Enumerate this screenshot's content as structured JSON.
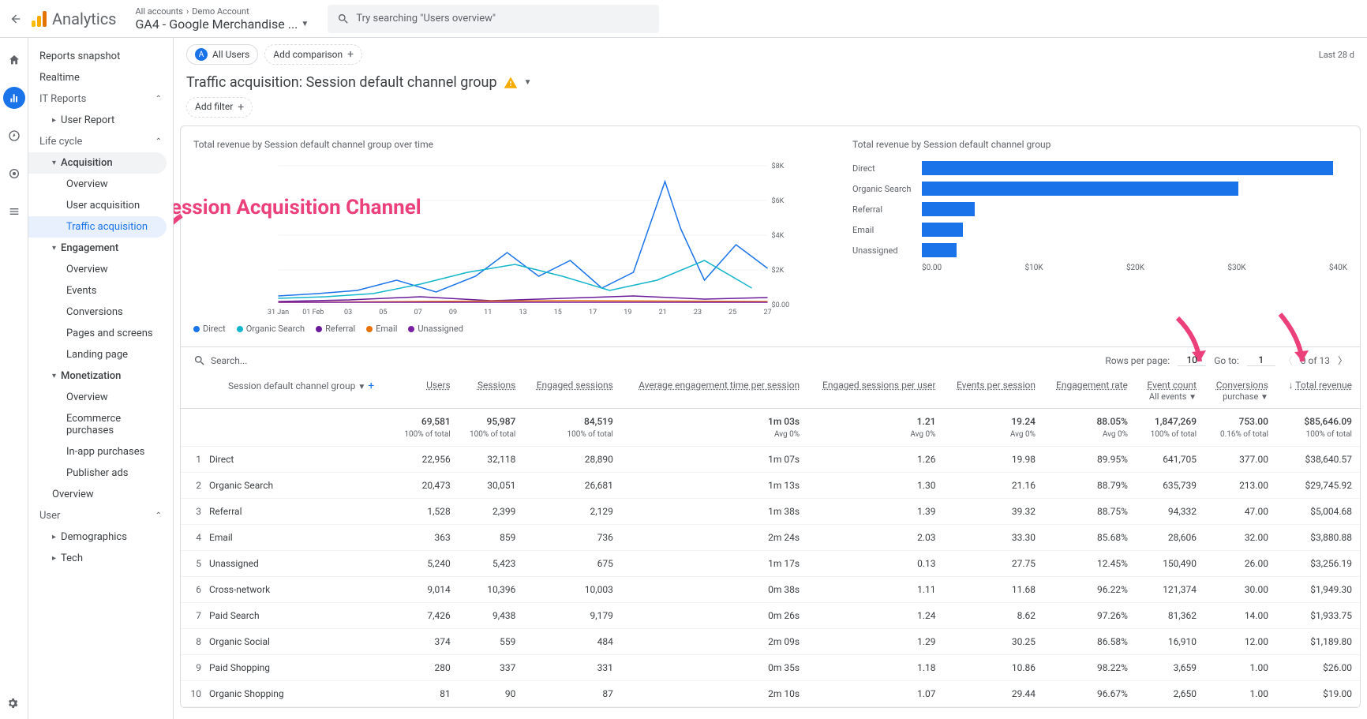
{
  "header": {
    "product": "Analytics",
    "breadcrumb_all": "All accounts",
    "breadcrumb_acct": "Demo Account",
    "property": "GA4 - Google Merchandise ...",
    "search_placeholder": "Try searching \"Users overview\""
  },
  "sidebar": {
    "snapshot": "Reports snapshot",
    "realtime": "Realtime",
    "it_reports": "IT Reports",
    "user_report": "User Report",
    "lifecycle": "Life cycle",
    "acquisition": "Acquisition",
    "acq_overview": "Overview",
    "user_acquisition": "User acquisition",
    "traffic_acquisition": "Traffic acquisition",
    "engagement": "Engagement",
    "eng_overview": "Overview",
    "events": "Events",
    "conversions": "Conversions",
    "pages": "Pages and screens",
    "landing": "Landing page",
    "monetization": "Monetization",
    "mon_overview": "Overview",
    "ecom": "Ecommerce purchases",
    "inapp": "In-app purchases",
    "pubads": "Publisher ads",
    "overview": "Overview",
    "user": "User",
    "demographics": "Demographics",
    "tech": "Tech"
  },
  "chips": {
    "all_users": "All Users",
    "add_comparison": "Add comparison",
    "date_label": "Last 28 d"
  },
  "title": {
    "text": "Traffic acquisition: Session default channel group",
    "add_filter": "Add filter"
  },
  "annotation": {
    "text": "Session Acquisition Channel"
  },
  "line_chart_title": "Total revenue by Session default channel group over time",
  "bar_chart_title": "Total revenue by Session default channel group",
  "chart_data": [
    {
      "type": "line",
      "title": "Total revenue by Session default channel group over time",
      "xlabel": "",
      "ylabel": "",
      "y_ticks": [
        "$0.00",
        "$2K",
        "$4K",
        "$6K",
        "$8K"
      ],
      "x_ticks": [
        "31 Jan",
        "01 Feb",
        "03",
        "05",
        "07",
        "09",
        "11",
        "13",
        "15",
        "17",
        "19",
        "21",
        "23",
        "25",
        "27"
      ],
      "series": [
        {
          "name": "Direct",
          "color": "#1a73e8"
        },
        {
          "name": "Organic Search",
          "color": "#12b5cb"
        },
        {
          "name": "Referral",
          "color": "#6a1b9a"
        },
        {
          "name": "Email",
          "color": "#e8710a"
        },
        {
          "name": "Unassigned",
          "color": "#7b1fa2"
        }
      ]
    },
    {
      "type": "bar",
      "title": "Total revenue by Session default channel group",
      "categories": [
        "Direct",
        "Organic Search",
        "Referral",
        "Email",
        "Unassigned"
      ],
      "values": [
        38640.57,
        29745.92,
        5004.68,
        3880.88,
        3256.19
      ],
      "x_ticks": [
        "$0.00",
        "$10K",
        "$20K",
        "$30K",
        "$40K"
      ],
      "xlim": [
        0,
        40000
      ]
    }
  ],
  "legend": [
    "Direct",
    "Organic Search",
    "Referral",
    "Email",
    "Unassigned"
  ],
  "legend_colors": [
    "#1a73e8",
    "#12b5cb",
    "#6a1b9a",
    "#e8710a",
    "#7b1fa2"
  ],
  "toolbar": {
    "search_placeholder": "Search...",
    "rows_per_page_label": "Rows per page:",
    "rows_per_page": "10",
    "goto_label": "Go to:",
    "goto": "1",
    "range": "0 of 13"
  },
  "table": {
    "dim_header": "Session default channel group",
    "columns": [
      "Users",
      "Sessions",
      "Engaged sessions",
      "Average engagement time per session",
      "Engaged sessions per user",
      "Events per session",
      "Engagement rate",
      "Event count",
      "Conversions",
      "Total revenue"
    ],
    "col_sub": {
      "event_count": "All events",
      "conversions": "purchase",
      "revenue_arrow": "↓"
    },
    "summary": [
      "69,581",
      "95,987",
      "84,519",
      "1m 03s",
      "1.21",
      "19.24",
      "88.05%",
      "1,847,269",
      "753.00",
      "$85,646.09"
    ],
    "summary_sub": [
      "100% of total",
      "100% of total",
      "100% of total",
      "Avg 0%",
      "Avg 0%",
      "Avg 0%",
      "Avg 0%",
      "100% of total",
      "0.16% of total",
      "100% of total"
    ],
    "rows": [
      {
        "n": "1",
        "dim": "Direct",
        "v": [
          "22,956",
          "32,118",
          "28,890",
          "1m 07s",
          "1.26",
          "19.98",
          "89.95%",
          "641,705",
          "377.00",
          "$38,640.57"
        ]
      },
      {
        "n": "2",
        "dim": "Organic Search",
        "v": [
          "20,473",
          "30,051",
          "26,681",
          "1m 13s",
          "1.30",
          "21.16",
          "88.79%",
          "635,739",
          "213.00",
          "$29,745.92"
        ]
      },
      {
        "n": "3",
        "dim": "Referral",
        "v": [
          "1,528",
          "2,399",
          "2,129",
          "1m 38s",
          "1.39",
          "39.32",
          "88.75%",
          "94,332",
          "47.00",
          "$5,004.68"
        ]
      },
      {
        "n": "4",
        "dim": "Email",
        "v": [
          "363",
          "859",
          "736",
          "2m 24s",
          "2.03",
          "33.30",
          "85.68%",
          "28,606",
          "32.00",
          "$3,880.88"
        ]
      },
      {
        "n": "5",
        "dim": "Unassigned",
        "v": [
          "5,240",
          "5,423",
          "675",
          "1m 17s",
          "0.13",
          "27.75",
          "12.45%",
          "150,490",
          "26.00",
          "$3,256.19"
        ]
      },
      {
        "n": "6",
        "dim": "Cross-network",
        "v": [
          "9,014",
          "10,396",
          "10,003",
          "0m 38s",
          "1.11",
          "11.68",
          "96.22%",
          "121,374",
          "30.00",
          "$1,949.30"
        ]
      },
      {
        "n": "7",
        "dim": "Paid Search",
        "v": [
          "7,426",
          "9,438",
          "9,179",
          "0m 26s",
          "1.24",
          "8.62",
          "97.26%",
          "81,362",
          "14.00",
          "$1,933.75"
        ]
      },
      {
        "n": "8",
        "dim": "Organic Social",
        "v": [
          "374",
          "559",
          "484",
          "2m 09s",
          "1.29",
          "30.25",
          "86.58%",
          "16,910",
          "12.00",
          "$1,189.80"
        ]
      },
      {
        "n": "9",
        "dim": "Paid Shopping",
        "v": [
          "280",
          "337",
          "331",
          "0m 35s",
          "1.18",
          "10.86",
          "98.22%",
          "3,659",
          "1.00",
          "$26.00"
        ]
      },
      {
        "n": "10",
        "dim": "Organic Shopping",
        "v": [
          "81",
          "90",
          "87",
          "2m 10s",
          "1.07",
          "29.44",
          "96.67%",
          "2,650",
          "1.00",
          "$19.00"
        ]
      }
    ]
  }
}
